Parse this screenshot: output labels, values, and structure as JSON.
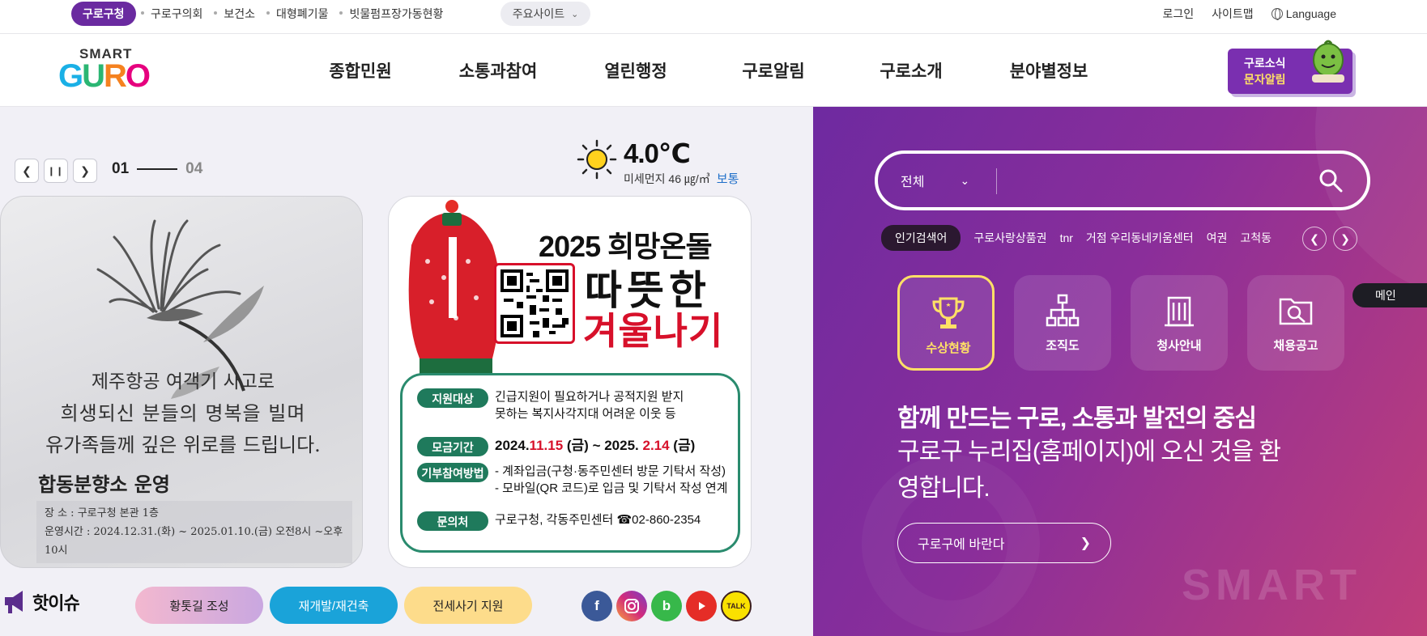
{
  "topbar": {
    "gov_label": "구로구청",
    "links": [
      "구로구의회",
      "보건소",
      "대형폐기물",
      "빗물펌프장가동현황"
    ],
    "main_sites": "주요사이트",
    "login": "로그인",
    "sitemap": "사이트맵",
    "language": "Language"
  },
  "header": {
    "logo_top": "SMART",
    "logo_main": "GURO",
    "nav": [
      "종합민원",
      "소통과참여",
      "열린행정",
      "구로알림",
      "구로소개",
      "분야별정보"
    ],
    "sms_line1": "구로소식",
    "sms_line2": "문자알림"
  },
  "slider": {
    "current": "01",
    "total": "04"
  },
  "weather": {
    "temp": "4.0℃",
    "dust": "미세먼지 46 ㎍/㎥",
    "level": "보통"
  },
  "card1": {
    "line1": "제주항공 여객기 사고로",
    "line2": "희생되신 분들의 명복을 빌며",
    "line3": "유가족들께 깊은 위로를 드립니다.",
    "memorial": "합동분향소 운영",
    "place": "장      소 : 구로구청 본관 1층",
    "hours": "운영시간 : 2024.12.31.(화) ~ 2025.01.10.(금) 오전8시 ~오후10시"
  },
  "card2": {
    "title": "2025 희망온돌",
    "title2": "따뜻한",
    "title3": "겨울나기",
    "rows": [
      {
        "tag": "지원대상",
        "text": "긴급지원이 필요하거나 공적지원 받지",
        "text2": "못하는 복지사각지대 어려운 이웃 등"
      },
      {
        "tag": "모금기간",
        "pre": "2024.",
        "r1": "11.15",
        "mid": " (금) ~ 2025. ",
        "r2": "2.14",
        "post": " (금)"
      },
      {
        "tag": "기부참여방법",
        "text": "- 계좌입금(구청·동주민센터 방문 기탁서 작성)",
        "text2": "- 모바일(QR 코드)로 입금 및 기탁서 작성 연계"
      },
      {
        "tag": "문의처",
        "text": "구로구청, 각동주민센터 ☎02-860-2354"
      }
    ]
  },
  "hotissue": {
    "label": "핫이슈",
    "pills": [
      "황톳길 조성",
      "재개발/재건축",
      "전세사기 지원"
    ]
  },
  "sns": {
    "facebook": "f",
    "blog": "b",
    "kakao": "TALK"
  },
  "search": {
    "category": "전체",
    "popular_label": "인기검색어",
    "keywords": [
      "구로사랑상품권",
      "tnr",
      "거점 우리동네키움센터",
      "여권",
      "고척동"
    ]
  },
  "quick": [
    "수상현황",
    "조직도",
    "청사안내",
    "채용공고"
  ],
  "main_badge": "메인",
  "hero": {
    "headline": "함께 만드는 구로, 소통과 발전의 중심",
    "sub": "구로구 누리집(홈페이지)에 오신 것을 환영합니다.",
    "hope_button": "구로구에 바란다",
    "watermark": "SMART"
  },
  "colors": {
    "brand_purple": "#6a2aa0",
    "accent_yellow": "#ffe066",
    "red": "#d7102a",
    "green": "#1f7a5c"
  }
}
